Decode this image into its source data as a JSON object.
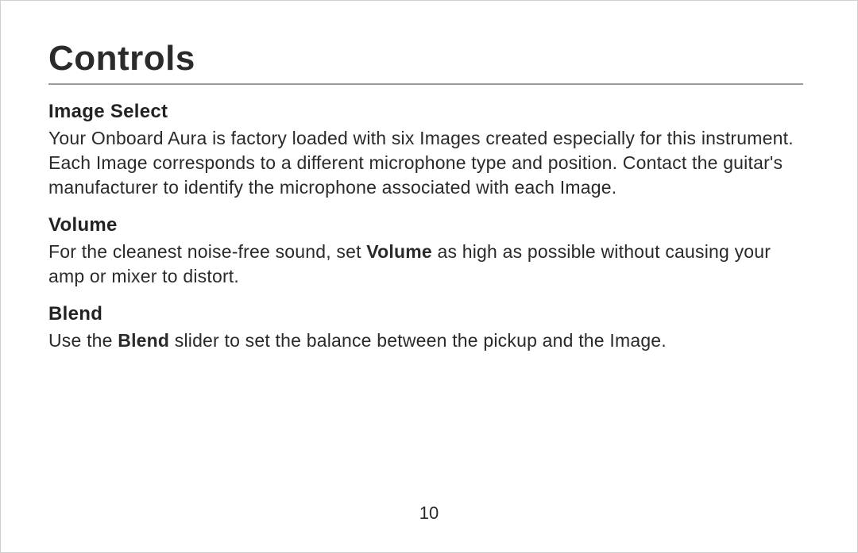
{
  "title": "Controls",
  "sections": [
    {
      "heading": "Image Select",
      "body_plain": "Your Onboard Aura is factory loaded with six Images created especially for this instrument. Each Image corresponds to a different microphone type and position. Contact the guitar's manufacturer to identify the microphone associated with each Image."
    },
    {
      "heading": "Volume",
      "body_before": "For the cleanest noise-free sound, set ",
      "body_bold": "Volume",
      "body_after": " as high as possible without caus­ing your amp or mixer to distort."
    },
    {
      "heading": "Blend",
      "body_before": "Use the ",
      "body_bold": "Blend",
      "body_after": " slider to set the balance between the pickup and the Image."
    }
  ],
  "page_number": "10"
}
